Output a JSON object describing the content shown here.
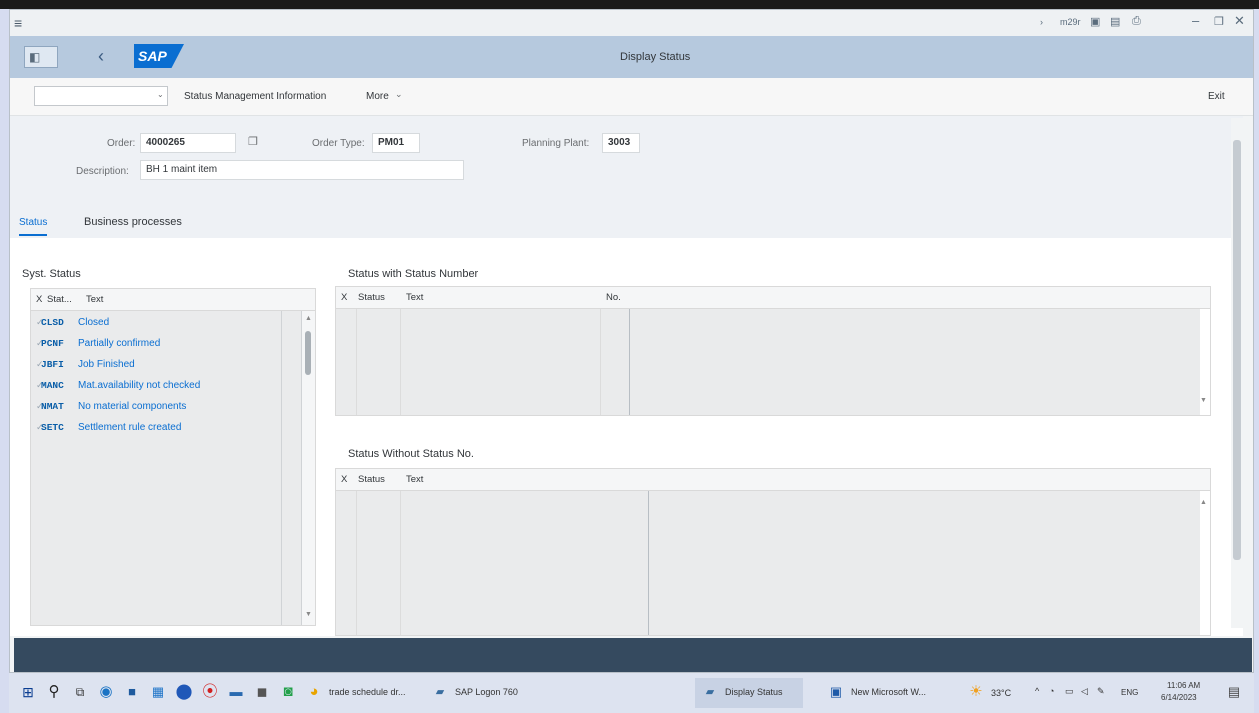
{
  "window": {
    "menu_icon": "hamburger-icon",
    "controls": [
      "m29r"
    ],
    "minimize_icon": "minimize-icon",
    "maximize_icon": "maximize-icon",
    "close_icon": "close-icon"
  },
  "header": {
    "title": "Display Status",
    "logo": "SAP",
    "back_icon": "chevron-left-icon"
  },
  "toolbar": {
    "dropdown_value": "",
    "status_mgmt_label": "Status Management Information",
    "more_label": "More",
    "exit_label": "Exit"
  },
  "form": {
    "order_label": "Order:",
    "order_value": "4000265",
    "order_type_label": "Order Type:",
    "order_type_value": "PM01",
    "planning_plant_label": "Planning Plant:",
    "planning_plant_value": "3003",
    "description_label": "Description:",
    "description_value": "BH 1 maint item"
  },
  "tabs": [
    {
      "label": "Status"
    },
    {
      "label": "Business processes"
    }
  ],
  "syst_status": {
    "title": "Syst. Status",
    "headers": [
      "X",
      "Stat...",
      "Text"
    ],
    "rows": [
      {
        "code": "CLSD",
        "text": "Closed"
      },
      {
        "code": "PCNF",
        "text": "Partially confirmed"
      },
      {
        "code": "JBFI",
        "text": "Job Finished"
      },
      {
        "code": "MANC",
        "text": "Mat.availability not checked"
      },
      {
        "code": "NMAT",
        "text": "No material components"
      },
      {
        "code": "SETC",
        "text": "Settlement rule created"
      }
    ]
  },
  "status_with_number": {
    "title": "Status with Status Number",
    "headers": [
      "X",
      "Status",
      "Text",
      "No."
    ]
  },
  "status_without_number": {
    "title": "Status Without Status No.",
    "headers": [
      "X",
      "Status",
      "Text"
    ]
  },
  "taskbar": {
    "items": [
      {
        "label": "trade schedule dr..."
      },
      {
        "label": "SAP Logon 760"
      },
      {
        "label": "Display Status"
      },
      {
        "label": "New Microsoft W..."
      }
    ],
    "weather": "33°C",
    "lang": "ENG",
    "time": "11:06 AM",
    "date": "6/14/2023"
  }
}
